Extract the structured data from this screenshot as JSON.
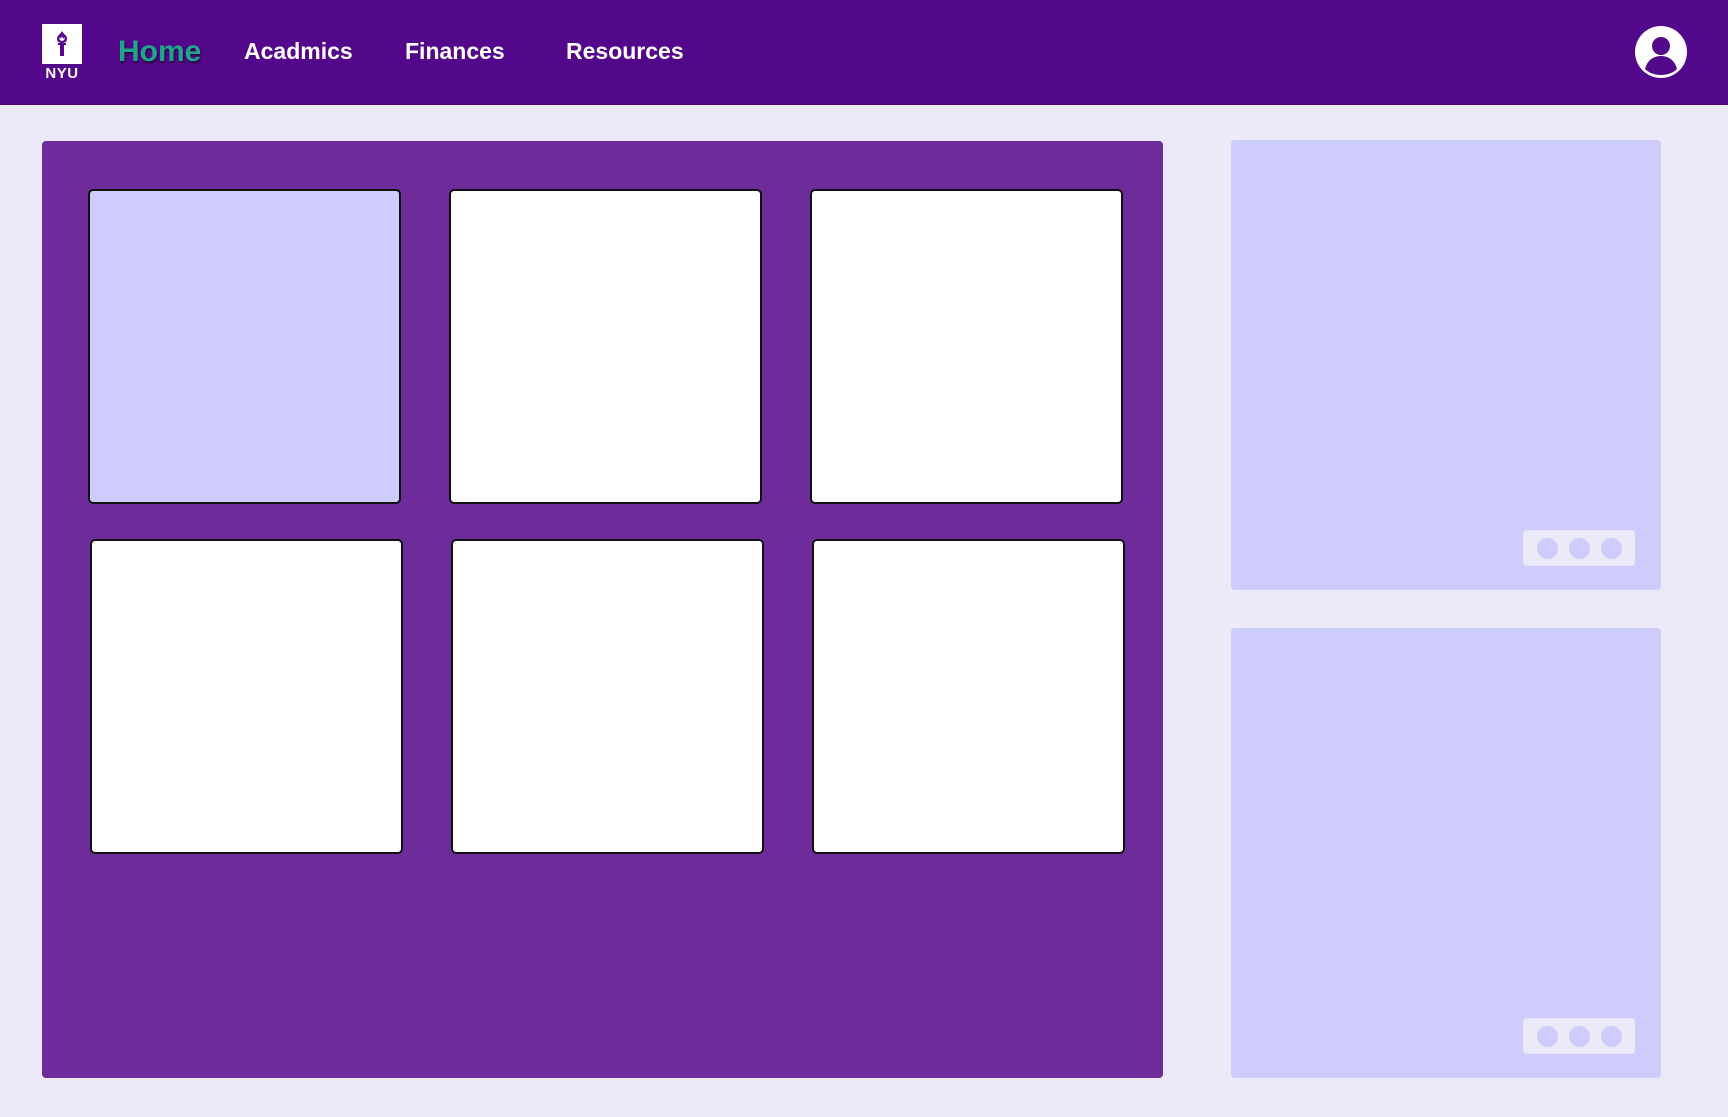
{
  "header": {
    "logo_text": "NYU",
    "nav": {
      "home": "Home",
      "academics": "Acadmics",
      "finances": "Finances",
      "resources": "Resources"
    },
    "active_item": "Home"
  },
  "main_grid": {
    "tiles": [
      {
        "state": "selected"
      },
      {
        "state": "default"
      },
      {
        "state": "default"
      },
      {
        "state": "default"
      },
      {
        "state": "default"
      },
      {
        "state": "default"
      }
    ]
  },
  "side_cards": [
    {
      "menu_icon": "more-horizontal-icon"
    },
    {
      "menu_icon": "more-horizontal-icon"
    }
  ],
  "colors": {
    "header_bg": "#53078A",
    "page_bg": "#ECEAF8",
    "panel_bg": "#6E2C9B",
    "card_bg": "#CECCFB",
    "active_nav": "#1FA58A",
    "tile_bg": "#FFFFFF"
  }
}
